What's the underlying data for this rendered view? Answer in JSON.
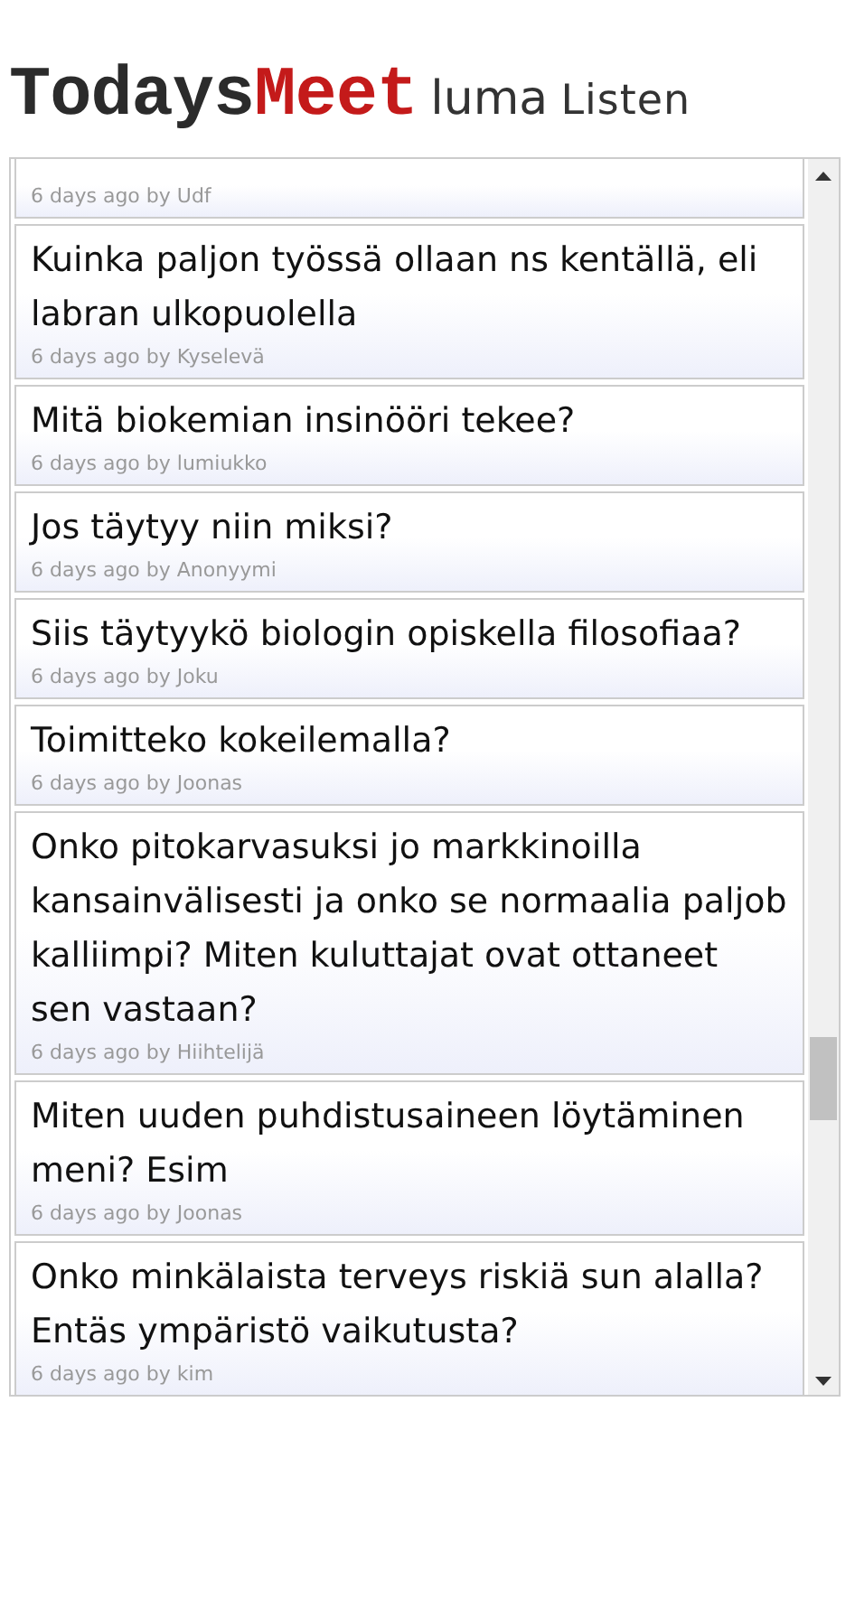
{
  "logo": {
    "first": "Todays",
    "second": "Meet"
  },
  "room": "luma",
  "section_title": "Listen",
  "messages": [
    {
      "meta": "6 days ago by Udf"
    },
    {
      "text": "Kuinka paljon työssä ollaan ns kentällä, eli labran ulkopuolella",
      "meta": "6 days ago by Kyselevä"
    },
    {
      "text": "Mitä biokemian insinööri tekee?",
      "meta": "6 days ago by lumiukko"
    },
    {
      "text": "Jos täytyy niin miksi?",
      "meta": "6 days ago by Anonyymi"
    },
    {
      "text": "Siis täytyykö biologin opiskella filosofiaa?",
      "meta": "6 days ago by Joku"
    },
    {
      "text": "Toimitteko kokeilemalla?",
      "meta": "6 days ago by Joonas"
    },
    {
      "text": "Onko pitokarvasuksi jo markkinoilla kansainvälisesti ja onko se normaalia paljob kalliimpi? Miten kuluttajat ovat ottaneet sen vastaan?",
      "meta": "6 days ago by Hiihtelijä"
    },
    {
      "text": "Miten uuden puhdistusaineen löytäminen meni? Esim",
      "meta": "6 days ago by Joonas"
    },
    {
      "text": "Onko minkälaista terveys riskiä sun alalla? Entäs ympäristö vaikutusta?",
      "meta": "6 days ago by kim"
    }
  ]
}
